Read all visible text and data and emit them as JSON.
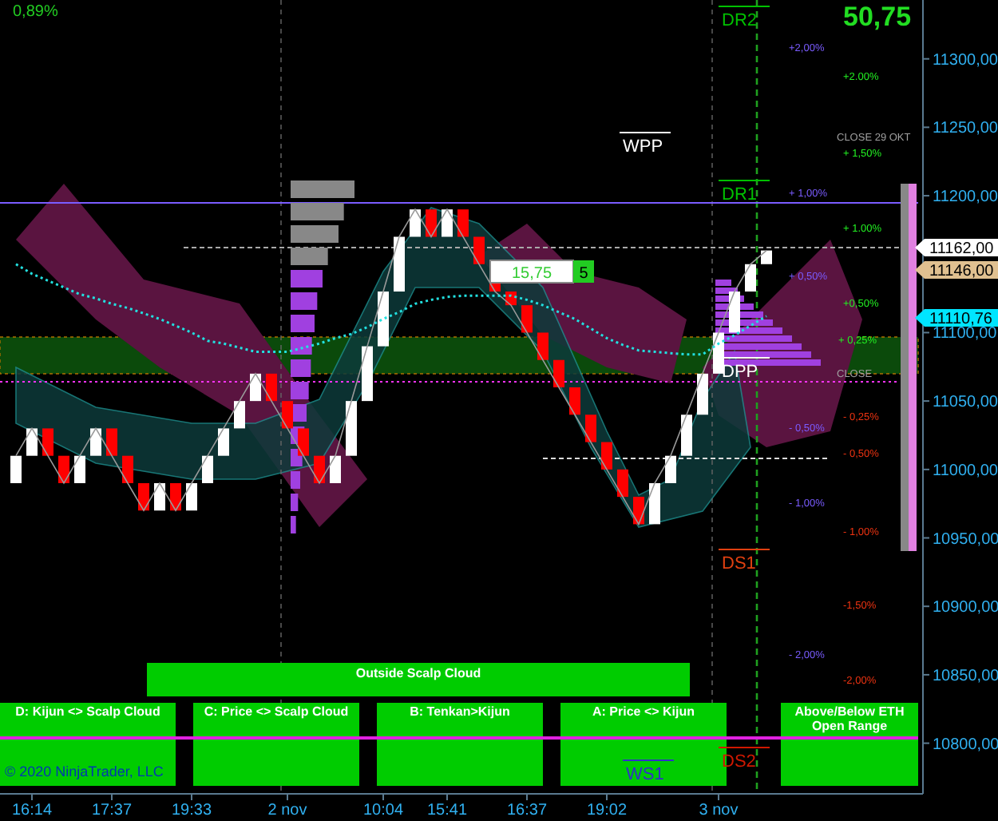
{
  "header": {
    "change_percent": "0,89%",
    "value": "50,75"
  },
  "chart": {
    "chart_data": {
      "type": "line",
      "categories": [
        null,
        "16:14",
        null,
        null,
        null,
        null,
        "17:37",
        null,
        null,
        null,
        null,
        "19:33",
        null,
        null,
        null,
        null,
        null,
        "2 nov",
        null,
        null,
        null,
        null,
        null,
        "10:04",
        null,
        null,
        null,
        "15:41",
        null,
        null,
        null,
        null,
        "16:37",
        null,
        null,
        null,
        null,
        "19:02",
        null,
        null,
        null,
        null,
        null,
        null,
        "3 nov",
        null,
        null,
        null
      ],
      "series": [
        {
          "color": "#9a9a9a",
          "values": [
            11010,
            11030,
            11010,
            10990,
            11010,
            11030,
            11010,
            10990,
            10970,
            10990,
            10970,
            10990,
            11010,
            11030,
            11050,
            11070,
            11050,
            11030,
            11010,
            10990,
            11010,
            11050,
            11090,
            11130,
            11170,
            11190,
            11170,
            11190,
            11170,
            11150,
            11130,
            11120,
            11100,
            11080,
            11060,
            11040,
            11020,
            11000,
            10980,
            10960,
            10990,
            11010,
            11040,
            11070,
            11100,
            11130,
            11150,
            11160
          ]
        },
        {
          "color": "#22e0e0",
          "line_style": "dotted",
          "values": [
            11150,
            11143,
            11138,
            11133,
            11128,
            11125,
            11121,
            11118,
            11114,
            11110,
            11105,
            11100,
            11094,
            11092,
            11089,
            11086,
            11086,
            11086,
            11089,
            11092,
            11096,
            11099,
            11104,
            11110,
            11115,
            11121,
            11124,
            11126,
            11127,
            11127,
            11127,
            11127,
            11124,
            11120,
            11115,
            11110,
            11103,
            11096,
            11091,
            11087,
            11086,
            11085,
            11084,
            11084,
            11092,
            11098,
            11105,
            11112
          ]
        }
      ],
      "ylim": [
        10763,
        11343
      ],
      "yticks": [
        {
          "value": 11300,
          "label": "11300,00"
        },
        {
          "value": 11250,
          "label": "11250,00"
        },
        {
          "value": 11200,
          "label": "11200,00"
        },
        {
          "value": 11100,
          "label": "11100,00"
        },
        {
          "value": 11050,
          "label": "11050,00"
        },
        {
          "value": 11000,
          "label": "11000,00"
        },
        {
          "value": 10950,
          "label": "10950,00"
        },
        {
          "value": 10900,
          "label": "10900,00"
        },
        {
          "value": 10850,
          "label": "10850,00"
        },
        {
          "value": 10800,
          "label": "10800,00"
        }
      ]
    }
  },
  "chart_labels": [
    {
      "kind": "pivot",
      "text": "DR2",
      "color": "#00c000"
    },
    {
      "kind": "pivot",
      "text": "WPP",
      "color": "#ffffff"
    },
    {
      "kind": "pivot",
      "text": "DR1",
      "color": "#00c000"
    },
    {
      "kind": "pivot",
      "text": "DPP",
      "color": "#ffffff"
    },
    {
      "kind": "pivot",
      "text": "DS1",
      "color": "#e04010"
    },
    {
      "kind": "pivot",
      "text": "DS2",
      "color": "#d01800"
    },
    {
      "kind": "pivot",
      "text": "WS1",
      "color": "#3030c8"
    },
    {
      "kind": "pct",
      "text": "CLOSE 29 OKT",
      "color": "#a0a0a0"
    },
    {
      "kind": "pct",
      "text": "CLOSE",
      "color": "#a0a0a0"
    },
    {
      "kind": "pct",
      "text": "+2,00%",
      "color": "#7a5cff"
    },
    {
      "kind": "pct",
      "text": "+ 1,00%",
      "color": "#7a5cff"
    },
    {
      "kind": "pct",
      "text": "+ 0,50%",
      "color": "#7a5cff"
    },
    {
      "kind": "pct",
      "text": "- 0,50%",
      "color": "#7a5cff"
    },
    {
      "kind": "pct",
      "text": "- 1,00%",
      "color": "#7a5cff"
    },
    {
      "kind": "pct",
      "text": "- 2,00%",
      "color": "#7a5cff"
    },
    {
      "kind": "pct",
      "text": "+2.00%",
      "color": "#22ee22"
    },
    {
      "kind": "pct",
      "text": "+ 1,50%",
      "color": "#22ee22"
    },
    {
      "kind": "pct",
      "text": "+ 1.00%",
      "color": "#22ee22"
    },
    {
      "kind": "pct",
      "text": "+0,50%",
      "color": "#22ee22"
    },
    {
      "kind": "pct",
      "text": "+ 0,25%",
      "color": "#22ee22"
    },
    {
      "kind": "pct",
      "text": "- 0,25%",
      "color": "#ee3311"
    },
    {
      "kind": "pct",
      "text": "- 0,50%",
      "color": "#ee3311"
    },
    {
      "kind": "pct",
      "text": "- 1,00%",
      "color": "#ee3311"
    },
    {
      "kind": "pct",
      "text": "-1,50%",
      "color": "#ee3311"
    },
    {
      "kind": "pct",
      "text": "-2,00%",
      "color": "#ee3311"
    }
  ],
  "value_box": {
    "text": "15,75",
    "badge": "5"
  },
  "price_tags": [
    {
      "text": "11162,00",
      "color": "#ffffff"
    },
    {
      "text": "11146,00",
      "color": "#e0c090"
    },
    {
      "text": "11110,76",
      "color": "#00e5ff"
    }
  ],
  "signals": [
    {
      "kind": "wide",
      "label": "Outside Scalp Cloud"
    },
    {
      "kind": "cell",
      "label": "D: Kijun <> Scalp Cloud"
    },
    {
      "kind": "cell",
      "label": "C: Price <> Scalp Cloud"
    },
    {
      "kind": "cell",
      "label": "B: Tenkan>Kijun"
    },
    {
      "kind": "cell",
      "label": "A: Price <> Kijun"
    },
    {
      "kind": "cell",
      "label": "Above/Below ETH Open Range"
    }
  ],
  "footer": {
    "copyright": "© 2020 NinjaTrader, LLC"
  }
}
